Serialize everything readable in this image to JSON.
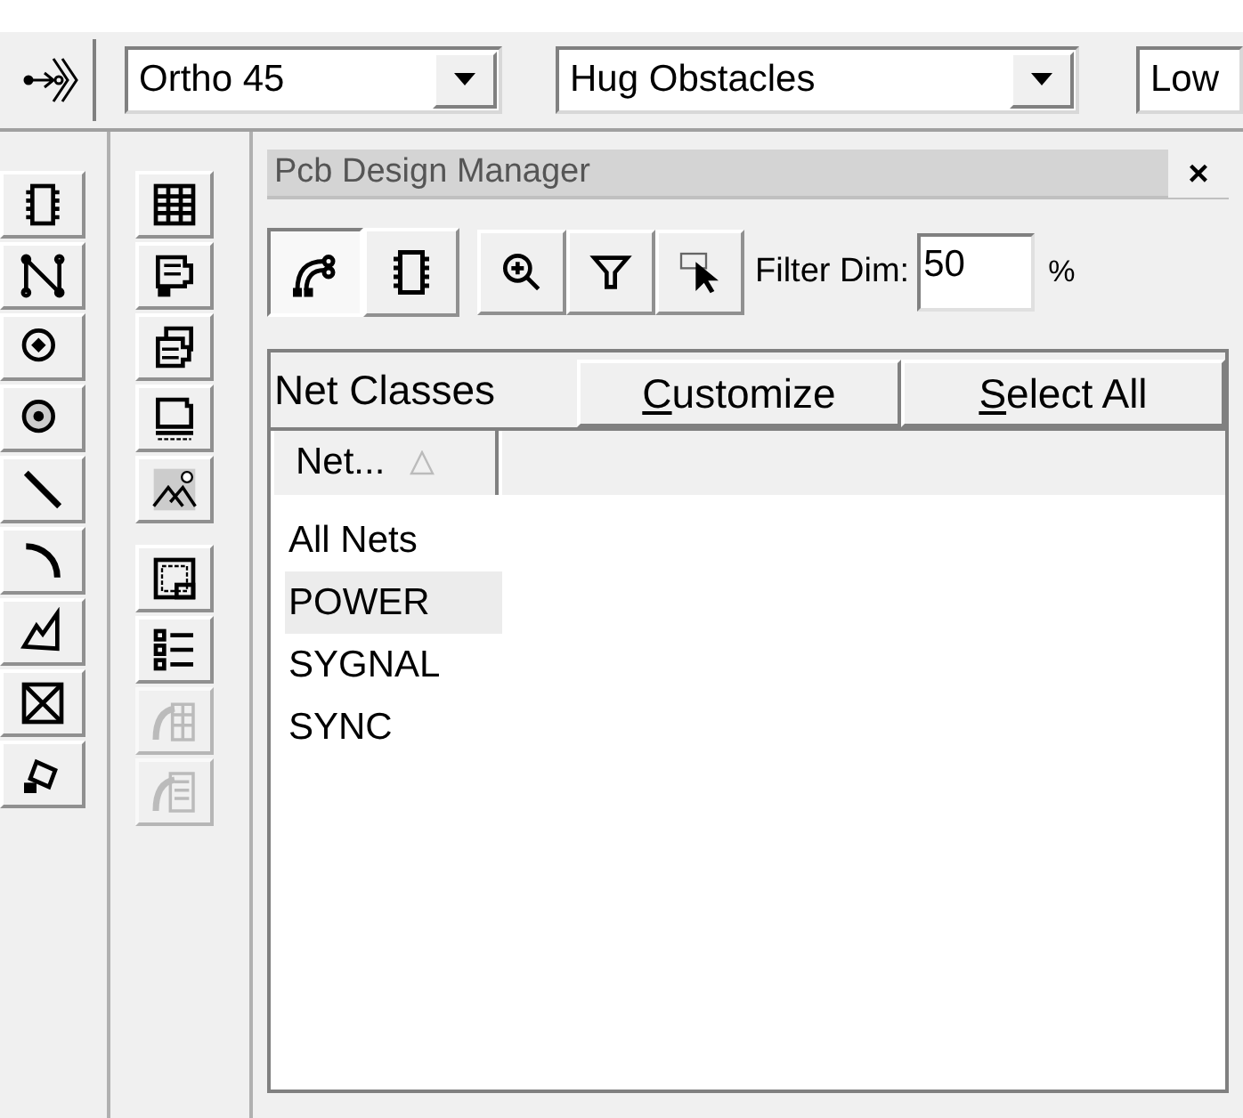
{
  "toolbar": {
    "route_mode": {
      "value": "Ortho 45"
    },
    "obstacle_mode": {
      "value": "Hug Obstacles"
    },
    "third_combo": {
      "value": "Low"
    }
  },
  "left_tools": [
    {
      "disabled": false
    },
    {
      "disabled": false
    },
    {
      "disabled": false
    },
    {
      "disabled": false
    },
    {
      "disabled": false
    },
    {
      "disabled": false
    },
    {
      "disabled": false
    },
    {
      "disabled": false
    },
    {
      "disabled": false
    }
  ],
  "right_tools": [
    {
      "disabled": false
    },
    {
      "disabled": false
    },
    {
      "disabled": false
    },
    {
      "disabled": false
    },
    {
      "disabled": false
    },
    {
      "disabled": false
    },
    {
      "disabled": false
    },
    {
      "disabled": true
    },
    {
      "disabled": true
    }
  ],
  "panel": {
    "title": "Pcb Design Manager",
    "close": "×",
    "view_buttons": [
      {
        "selected": true
      },
      {
        "selected": false
      }
    ],
    "filter_label": "Filter Dim:",
    "filter_value": "50",
    "percent": "%",
    "tabs": [
      {
        "label": "Net Classes",
        "selected": true,
        "underline_first": false
      },
      {
        "label": "Customize",
        "selected": false,
        "underline_first": true
      },
      {
        "label": "Select All",
        "selected": false,
        "underline_first": true
      }
    ],
    "columns": [
      {
        "label": "Net...",
        "sorted": true
      },
      {
        "sorted": false
      }
    ],
    "rows": [
      {
        "name": "All Nets",
        "selected": false
      },
      {
        "name": "POWER",
        "selected": true
      },
      {
        "name": "SYGNAL",
        "selected": false
      },
      {
        "name": "SYNC",
        "selected": false
      }
    ]
  }
}
